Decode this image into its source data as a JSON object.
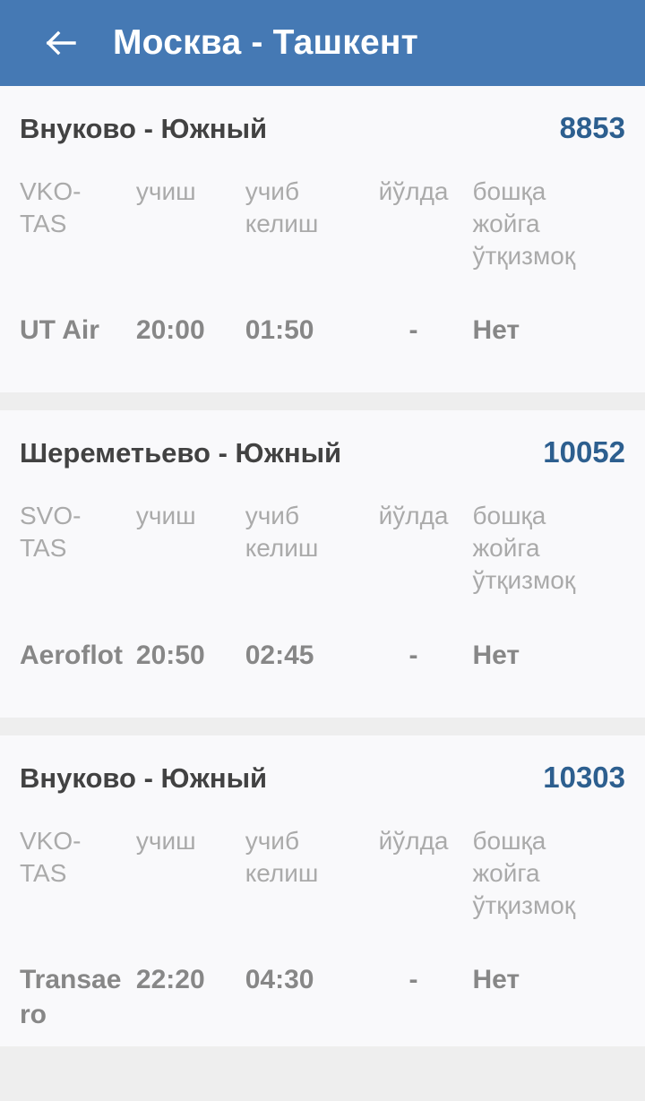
{
  "appbar": {
    "back_icon": "arrow-left-icon",
    "title": "Москва - Ташкент",
    "background_color": "#4579b4",
    "title_color": "#ffffff"
  },
  "colors": {
    "page_background": "#eeeeee",
    "card_background": "#f9f9fb",
    "card_title": "#424242",
    "flight_number": "#2d5f8f",
    "column_header": "#aaaaaa",
    "cell_value": "#878787"
  },
  "columns": {
    "departure_label": "учиш",
    "arrival_label": "учиб келиш",
    "enroute_label": "йўлда",
    "transfer_label": "бошқа жойга ўтқизмоқ"
  },
  "flights": [
    {
      "title": "Внуково - Южный",
      "number": "8853",
      "headers": [
        "VKO-TAS",
        "учиш",
        "учиб келиш",
        "йўлда",
        "бошқа жойга ўтқизмоқ"
      ],
      "values": [
        "UT Air",
        "20:00",
        "01:50",
        "-",
        "Нет"
      ]
    },
    {
      "title": "Шереметьево - Южный",
      "number": "10052",
      "headers": [
        "SVO-TAS",
        "учиш",
        "учиб келиш",
        "йўлда",
        "бошқа жойга ўтқизмоқ"
      ],
      "values": [
        "Aeroflot",
        "20:50",
        "02:45",
        "-",
        "Нет"
      ]
    },
    {
      "title": "Внуково - Южный",
      "number": "10303",
      "headers": [
        "VKO-TAS",
        "учиш",
        "учиб келиш",
        "йўлда",
        "бошқа жойга ўтқизмоқ"
      ],
      "values": [
        "Transaero",
        "22:20",
        "04:30",
        "-",
        "Нет"
      ]
    }
  ]
}
